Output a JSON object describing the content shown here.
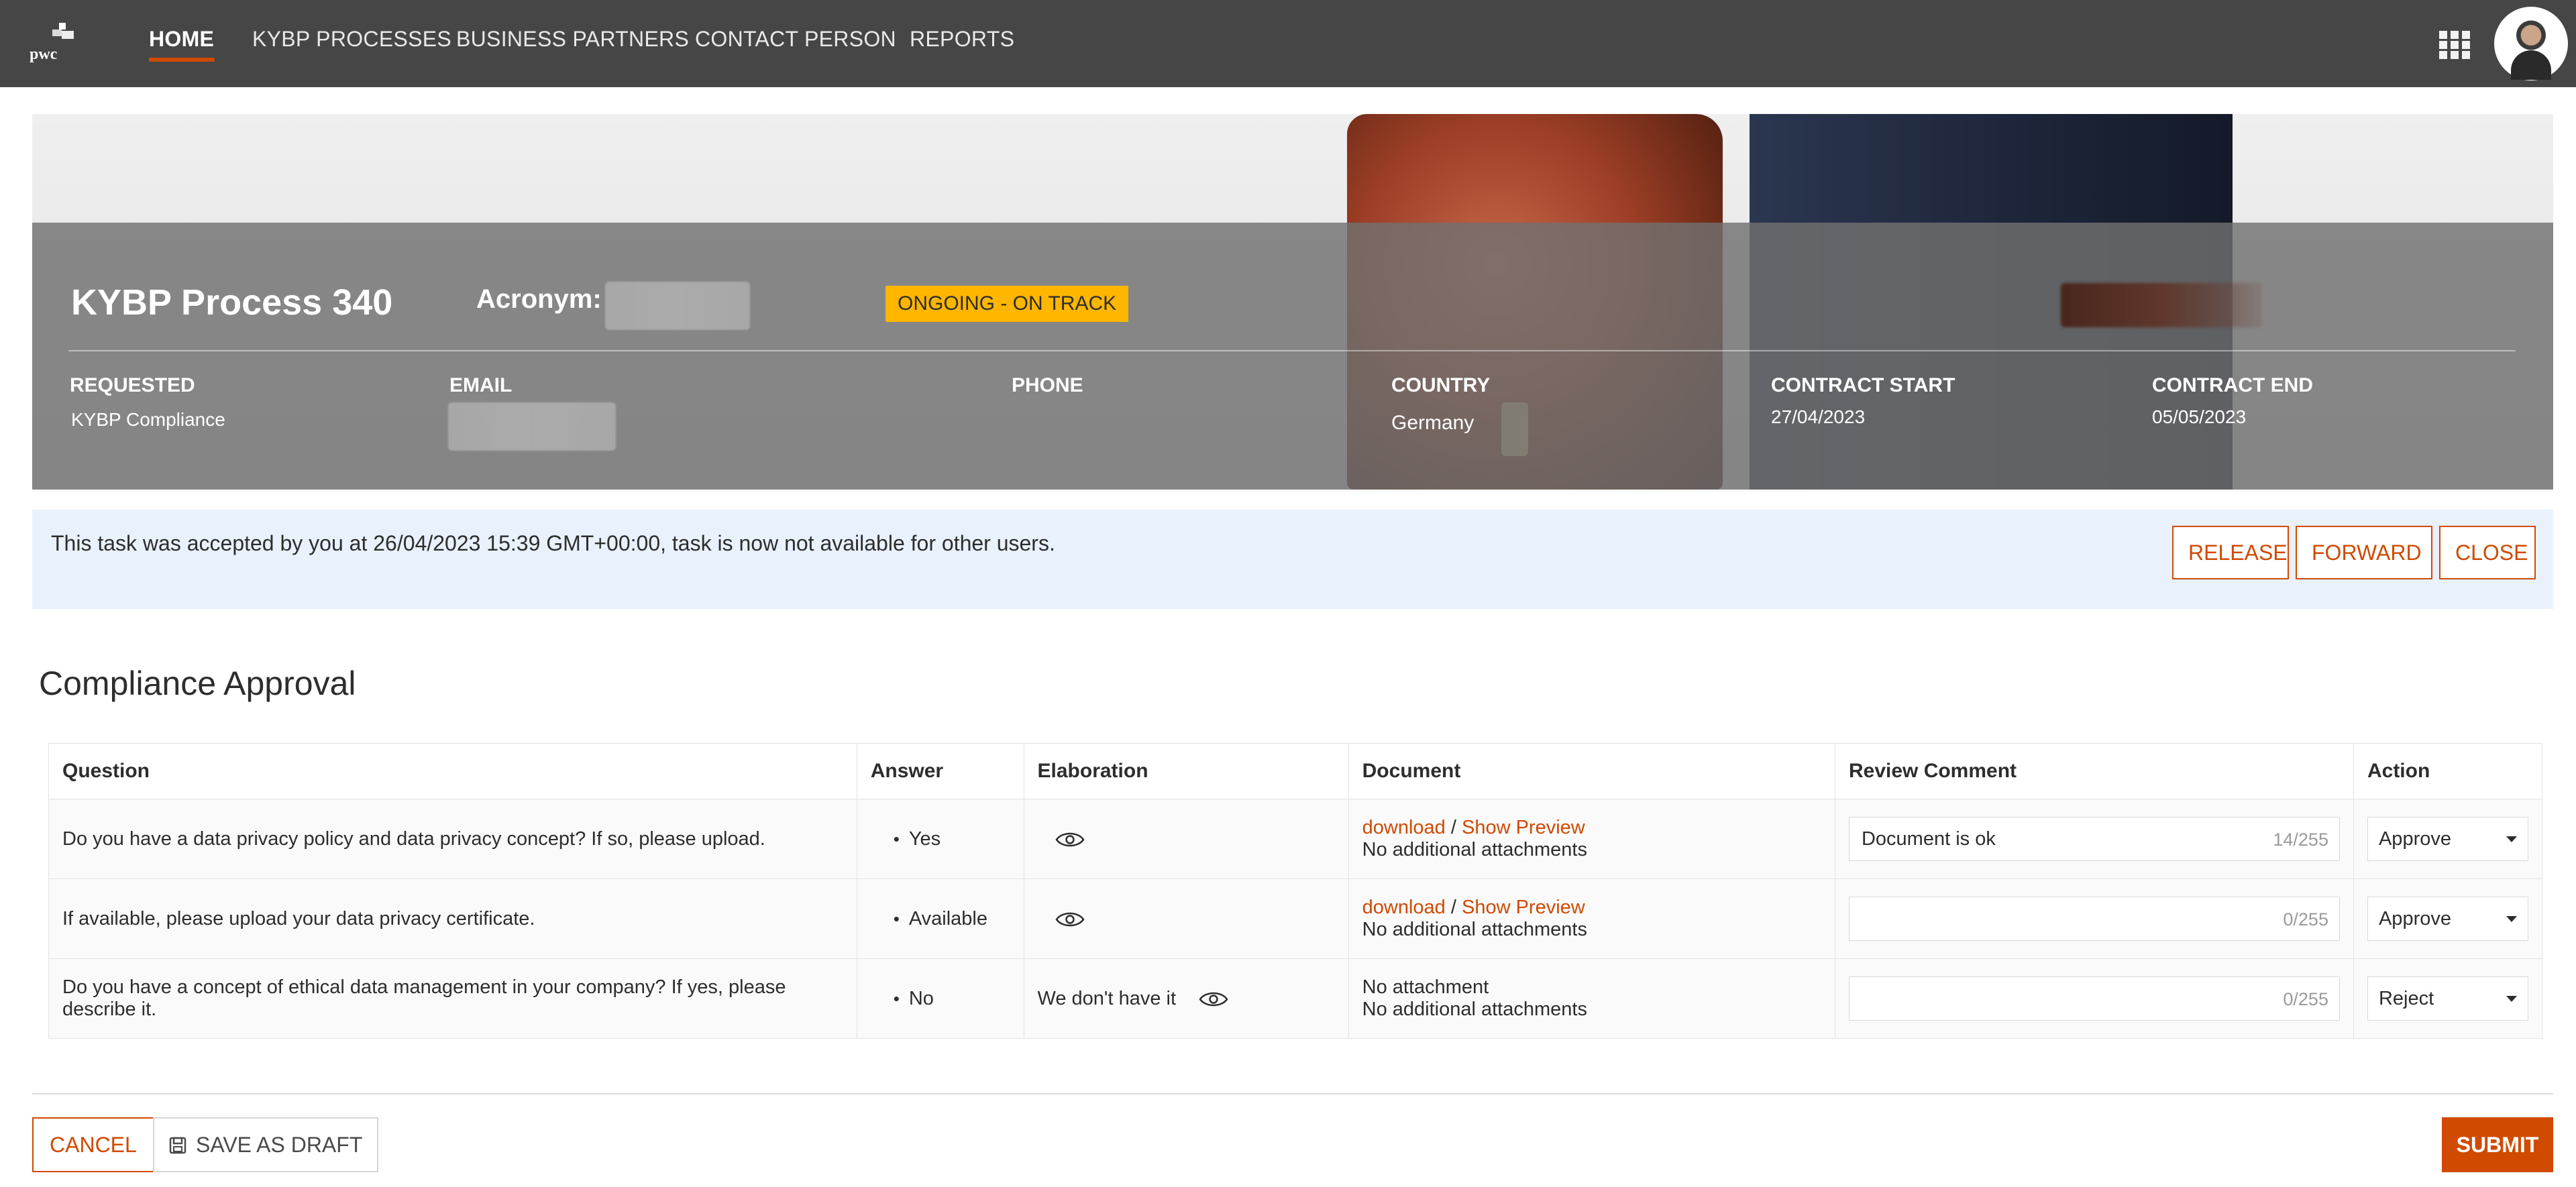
{
  "nav": {
    "logo_text": "pwc",
    "items": [
      "HOME",
      "KYBP PROCESSES",
      "BUSINESS PARTNERS",
      "CONTACT PERSON",
      "REPORTS"
    ],
    "active": "HOME",
    "icons": [
      "apps-grid-icon",
      "user-avatar"
    ]
  },
  "hero": {
    "title": "KYBP Process 340",
    "acronym_label": "Acronym:",
    "status": "ONGOING - ON TRACK",
    "meta": {
      "requested_label": "REQUESTED",
      "requested_value": "KYBP Compliance",
      "email_label": "EMAIL",
      "phone_label": "PHONE",
      "country_label": "COUNTRY",
      "country_value": "Germany",
      "contract_start_label": "CONTRACT START",
      "contract_start_value": "27/04/2023",
      "contract_end_label": "CONTRACT END",
      "contract_end_value": "05/05/2023"
    }
  },
  "info": {
    "message": "This task was accepted by you at 26/04/2023 15:39 GMT+00:00, task is now not available for other users.",
    "buttons": [
      "RELEASE",
      "FORWARD",
      "CLOSE"
    ]
  },
  "section": {
    "title": "Compliance Approval"
  },
  "table": {
    "headers": [
      "Question",
      "Answer",
      "Elaboration",
      "Document",
      "Review Comment",
      "Action"
    ],
    "rows": [
      {
        "question": "Do you have a data privacy policy and data privacy concept? If so, please upload.",
        "answer": "Yes",
        "elaboration": "",
        "doc_download": "download",
        "doc_sep": "/",
        "doc_preview": "Show Preview",
        "doc_line1": "",
        "doc_extra": "No additional attachments",
        "comment": "Document is ok",
        "count": "14/255",
        "action": "Approve"
      },
      {
        "question": "If available, please upload your data privacy certificate.",
        "answer": "Available",
        "elaboration": "",
        "doc_download": "download",
        "doc_sep": "/",
        "doc_preview": "Show Preview",
        "doc_line1": "",
        "doc_extra": "No additional attachments",
        "comment": "",
        "count": "0/255",
        "action": "Approve"
      },
      {
        "question": "Do you have a concept of ethical data management in your company? If yes, please describe it.",
        "answer": "No",
        "elaboration": "We don't have it",
        "doc_download": "",
        "doc_sep": "",
        "doc_preview": "",
        "doc_line1": "No attachment",
        "doc_extra": "No additional attachments",
        "comment": "",
        "count": "0/255",
        "action": "Reject"
      }
    ]
  },
  "footer": {
    "cancel": "CANCEL",
    "save_draft": "SAVE AS DRAFT",
    "submit": "SUBMIT"
  },
  "colors": {
    "accent": "#d04a02",
    "nav_bg": "#464646",
    "status_badge": "#ffb600",
    "info_bg": "#e9f1fc"
  }
}
